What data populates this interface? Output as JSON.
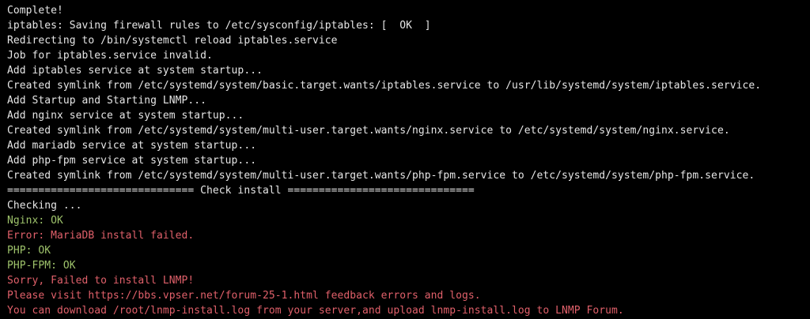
{
  "terminal": {
    "colors": {
      "background": "#000000",
      "normal": "#e6e6e6",
      "green": "#9ec36b",
      "red": "#e0606a"
    },
    "lines": [
      {
        "text": "Complete!",
        "color": "normal"
      },
      {
        "text": "iptables: Saving firewall rules to /etc/sysconfig/iptables: [  OK  ]",
        "color": "normal"
      },
      {
        "text": "Redirecting to /bin/systemctl reload iptables.service",
        "color": "normal"
      },
      {
        "text": "Job for iptables.service invalid.",
        "color": "normal"
      },
      {
        "text": "Add iptables service at system startup...",
        "color": "normal"
      },
      {
        "text": "Created symlink from /etc/systemd/system/basic.target.wants/iptables.service to /usr/lib/systemd/system/iptables.service.",
        "color": "normal"
      },
      {
        "text": "Add Startup and Starting LNMP...",
        "color": "normal"
      },
      {
        "text": "Add nginx service at system startup...",
        "color": "normal"
      },
      {
        "text": "Created symlink from /etc/systemd/system/multi-user.target.wants/nginx.service to /etc/systemd/system/nginx.service.",
        "color": "normal"
      },
      {
        "text": "Add mariadb service at system startup...",
        "color": "normal"
      },
      {
        "text": "Add php-fpm service at system startup...",
        "color": "normal"
      },
      {
        "text": "Created symlink from /etc/systemd/system/multi-user.target.wants/php-fpm.service to /etc/systemd/system/php-fpm.service.",
        "color": "normal"
      },
      {
        "text": "============================== Check install ==============================",
        "color": "normal"
      },
      {
        "text": "Checking ...",
        "color": "normal"
      },
      {
        "text": "Nginx: OK",
        "color": "green"
      },
      {
        "text": "Error: MariaDB install failed.",
        "color": "red"
      },
      {
        "text": "PHP: OK",
        "color": "green"
      },
      {
        "text": "PHP-FPM: OK",
        "color": "green"
      },
      {
        "text": "Sorry, Failed to install LNMP!",
        "color": "red"
      },
      {
        "text": "Please visit https://bbs.vpser.net/forum-25-1.html feedback errors and logs.",
        "color": "red"
      },
      {
        "text": "You can download /root/lnmp-install.log from your server,and upload lnmp-install.log to LNMP Forum.",
        "color": "red"
      }
    ]
  }
}
